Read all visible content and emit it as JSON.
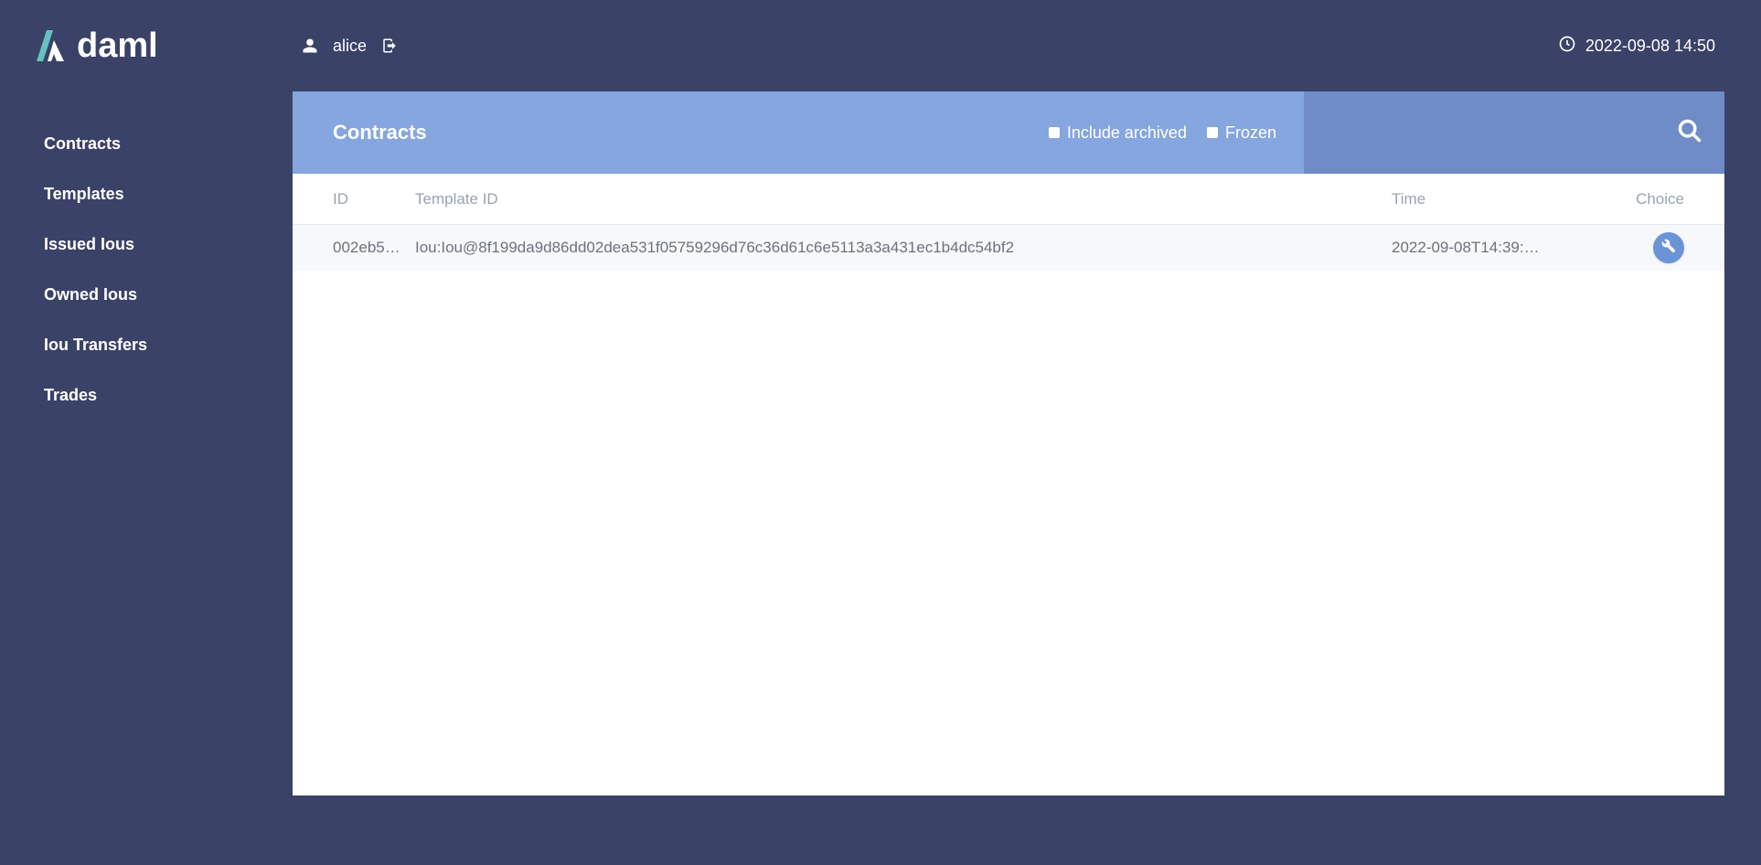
{
  "app": {
    "name": "daml"
  },
  "header": {
    "user": "alice",
    "datetime": "2022-09-08 14:50"
  },
  "sidebar": {
    "items": [
      {
        "label": "Contracts"
      },
      {
        "label": "Templates"
      },
      {
        "label": "Issued Ious"
      },
      {
        "label": "Owned Ious"
      },
      {
        "label": "Iou Transfers"
      },
      {
        "label": "Trades"
      }
    ]
  },
  "panel": {
    "title": "Contracts",
    "filters": {
      "include_archived_label": "Include archived",
      "frozen_label": "Frozen"
    }
  },
  "table": {
    "headers": {
      "id": "ID",
      "template_id": "Template ID",
      "time": "Time",
      "choice": "Choice"
    },
    "rows": [
      {
        "id": "002eb5…",
        "template_id": "Iou:Iou@8f199da9d86dd02dea531f05759296d76c36d61c6e5113a3a431ec1b4dc54bf2",
        "time": "2022-09-08T14:39:…"
      }
    ]
  }
}
